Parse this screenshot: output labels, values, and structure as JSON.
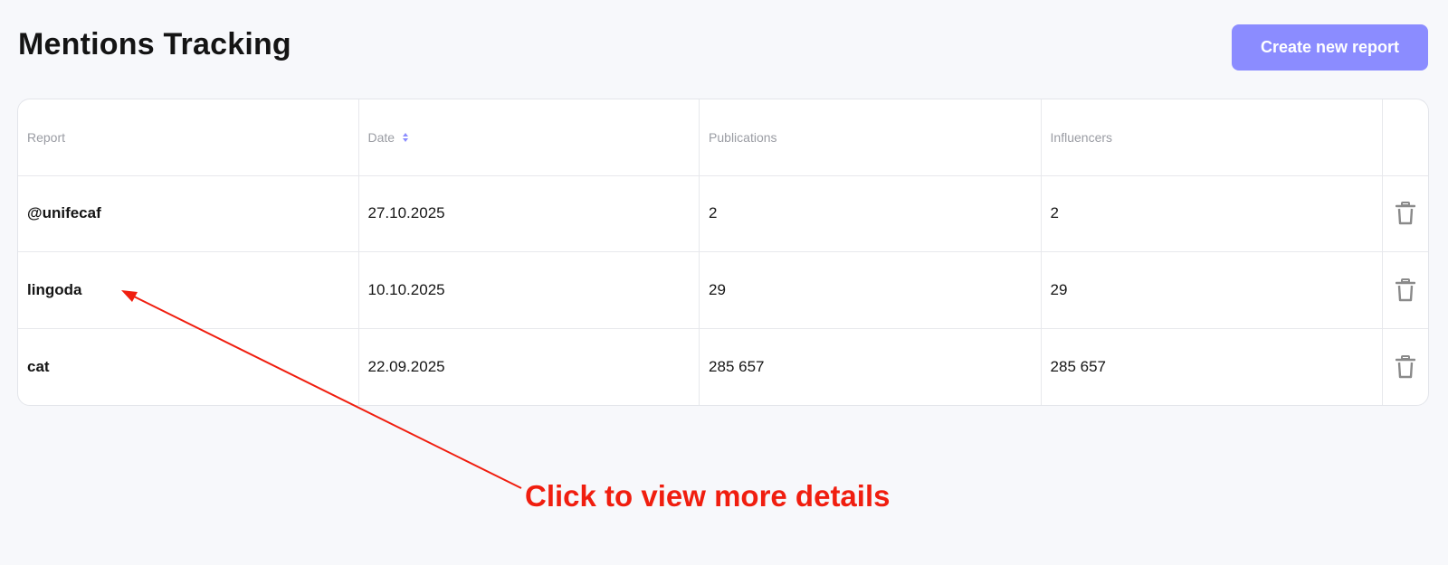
{
  "header": {
    "title": "Mentions Tracking",
    "create_button_label": "Create new report"
  },
  "table": {
    "columns": [
      "Report",
      "Date",
      "Publications",
      "Influencers"
    ],
    "sort_icon": "sort-up-down-icon",
    "rows": [
      {
        "report": "@unifecaf",
        "date": "27.10.2025",
        "publications": "2",
        "influencers": "2",
        "action_icon": "trash-icon"
      },
      {
        "report": "lingoda",
        "date": "10.10.2025",
        "publications": "29",
        "influencers": "29",
        "action_icon": "trash-icon"
      },
      {
        "report": "cat",
        "date": "22.09.2025",
        "publications": "285 657",
        "influencers": "285 657",
        "action_icon": "trash-icon"
      }
    ]
  },
  "annotation": {
    "text": "Click to view more details",
    "color": "#f01e0f"
  },
  "colors": {
    "accent": "#8b8cff",
    "background": "#f7f8fb"
  }
}
